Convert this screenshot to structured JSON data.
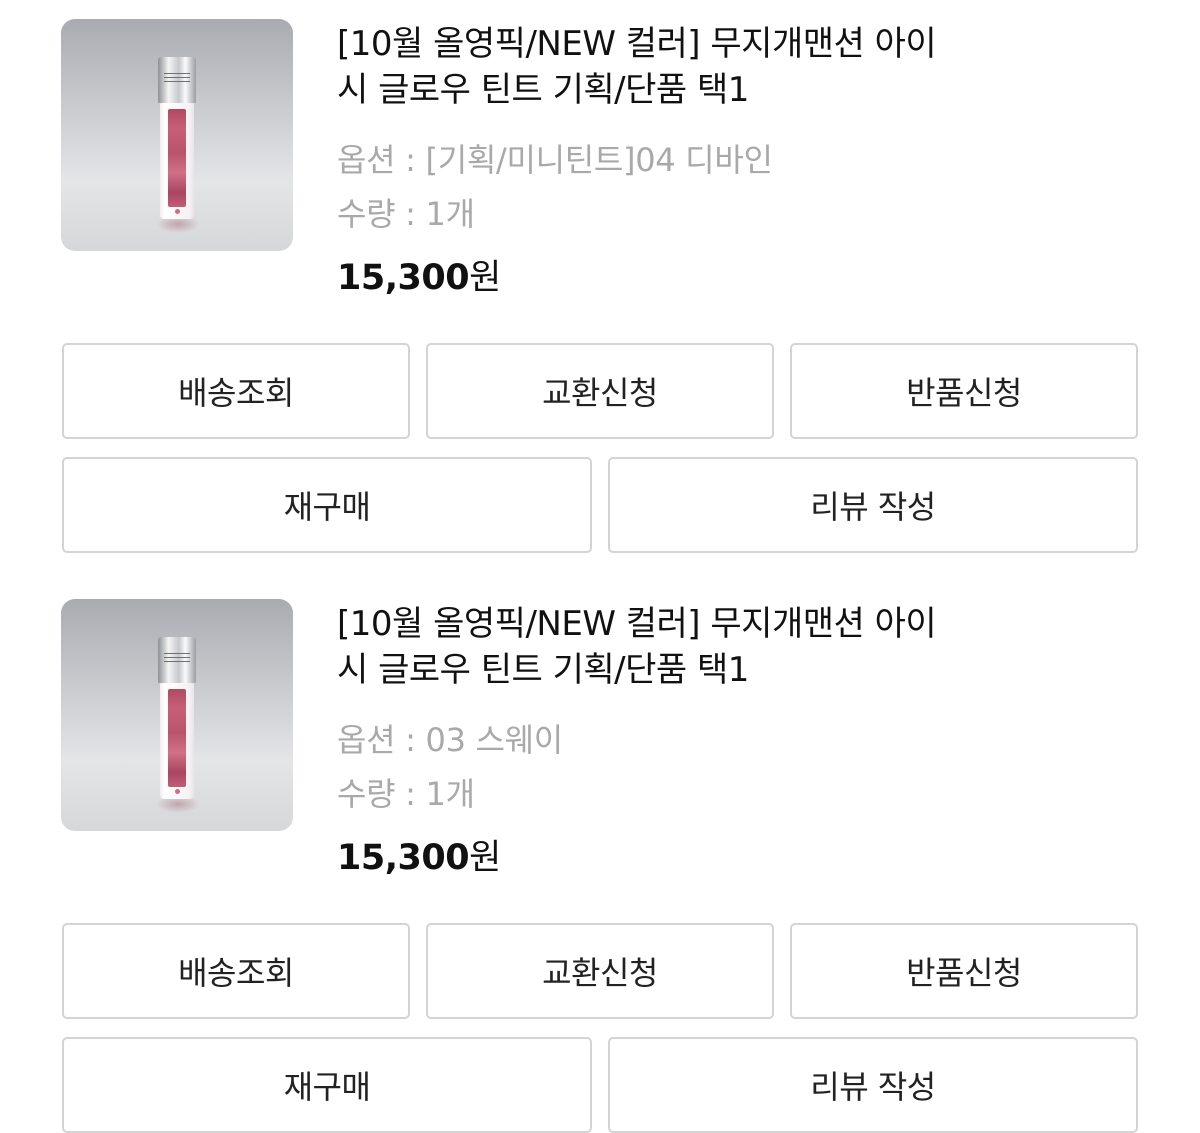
{
  "orders": [
    {
      "product_title_line1": "[10월 올영픽/NEW 컬러] 무지개맨션 아이",
      "product_title_line2": "시 글로우 틴트 기획/단품 택1",
      "option": "옵션 : [기획/미니틴트]04 디바인",
      "quantity": "수량 : 1개",
      "price_amount": "15,300",
      "price_unit": "원",
      "image_icon": "tint-bottle-product-image",
      "buttons": {
        "track_delivery": "배송조회",
        "request_exchange": "교환신청",
        "request_return": "반품신청",
        "repurchase": "재구매",
        "write_review": "리뷰 작성"
      }
    },
    {
      "product_title_line1": "[10월 올영픽/NEW 컬러] 무지개맨션 아이",
      "product_title_line2": "시 글로우 틴트 기획/단품 택1",
      "option": "옵션 : 03 스웨이",
      "quantity": "수량 : 1개",
      "price_amount": "15,300",
      "price_unit": "원",
      "image_icon": "tint-bottle-product-image",
      "buttons": {
        "track_delivery": "배송조회",
        "request_exchange": "교환신청",
        "request_return": "반품신청",
        "repurchase": "재구매",
        "write_review": "리뷰 작성"
      }
    }
  ],
  "colors": {
    "text_primary": "#111111",
    "text_muted": "#a9a9a9",
    "button_border": "#d4d4d4",
    "tint": "#c85f78"
  }
}
